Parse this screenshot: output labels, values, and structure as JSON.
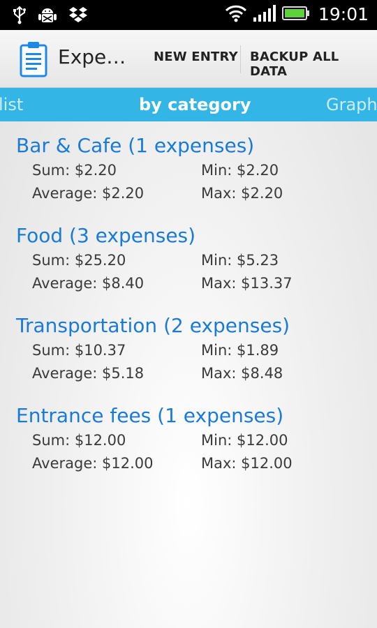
{
  "status_bar": {
    "time": "19:01",
    "icons": [
      "usb-icon",
      "android-debug-icon",
      "dropbox-icon",
      "wifi-icon",
      "signal-icon",
      "battery-icon"
    ]
  },
  "action_bar": {
    "title": "Expe…",
    "new_entry": "NEW ENTRY",
    "backup": "BACKUP ALL DATA"
  },
  "tabs": {
    "list": "list",
    "by_category": "by category",
    "graph": "Graph"
  },
  "categories": [
    {
      "title": "Bar & Cafe (1 expenses)",
      "sum": "Sum: $2.20",
      "min": "Min: $2.20",
      "average": "Average: $2.20",
      "max": "Max: $2.20"
    },
    {
      "title": "Food (3 expenses)",
      "sum": "Sum: $25.20",
      "min": "Min: $5.23",
      "average": "Average: $8.40",
      "max": "Max: $13.37"
    },
    {
      "title": "Transportation (2 expenses)",
      "sum": "Sum: $10.37",
      "min": "Min: $1.89",
      "average": "Average: $5.18",
      "max": "Max: $8.48"
    },
    {
      "title": "Entrance fees (1 expenses)",
      "sum": "Sum: $12.00",
      "min": "Min: $12.00",
      "average": "Average: $12.00",
      "max": "Max: $12.00"
    }
  ],
  "colors": {
    "accent": "#33b5e5",
    "category_title": "#1a7bd6",
    "battery": "#5fd13a"
  }
}
